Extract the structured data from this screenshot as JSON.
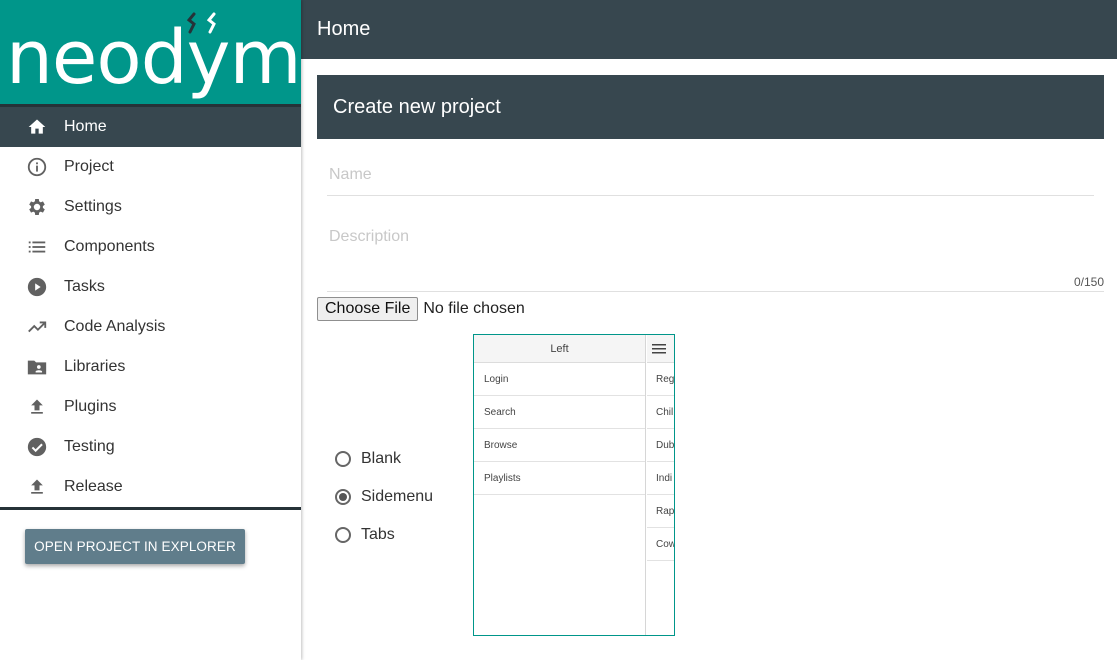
{
  "brand": {
    "logo_text": "neodym",
    "color": "#00968a"
  },
  "header": {
    "title": "Home"
  },
  "sidebar": {
    "items": [
      {
        "label": "Home",
        "icon": "home-icon",
        "active": true
      },
      {
        "label": "Project",
        "icon": "info-icon"
      },
      {
        "label": "Settings",
        "icon": "gear-icon"
      },
      {
        "label": "Components",
        "icon": "list-icon"
      },
      {
        "label": "Tasks",
        "icon": "play-icon"
      },
      {
        "label": "Code Analysis",
        "icon": "trending-icon"
      },
      {
        "label": "Libraries",
        "icon": "folder-user-icon"
      },
      {
        "label": "Plugins",
        "icon": "upload-icon"
      },
      {
        "label": "Testing",
        "icon": "check-circle-icon"
      },
      {
        "label": "Release",
        "icon": "upload-icon"
      }
    ],
    "open_button": "OPEN PROJECT IN EXPLORER"
  },
  "form": {
    "card_title": "Create new project",
    "name_placeholder": "Name",
    "description_placeholder": "Description",
    "description_counter": "0/150",
    "file_button": "Choose File",
    "file_status": "No file chosen",
    "templates": [
      {
        "label": "Blank",
        "checked": false
      },
      {
        "label": "Sidemenu",
        "checked": true
      },
      {
        "label": "Tabs",
        "checked": false
      }
    ]
  },
  "preview": {
    "left_title": "Left",
    "left_items": [
      "Login",
      "Search",
      "Browse",
      "Playlists"
    ],
    "right_items": [
      "Reg",
      "Chil",
      "Dub",
      "Indi",
      "Rap",
      "Cow"
    ]
  },
  "colors": {
    "header": "#37474f",
    "button": "#607d8b",
    "accent": "#00968a"
  }
}
